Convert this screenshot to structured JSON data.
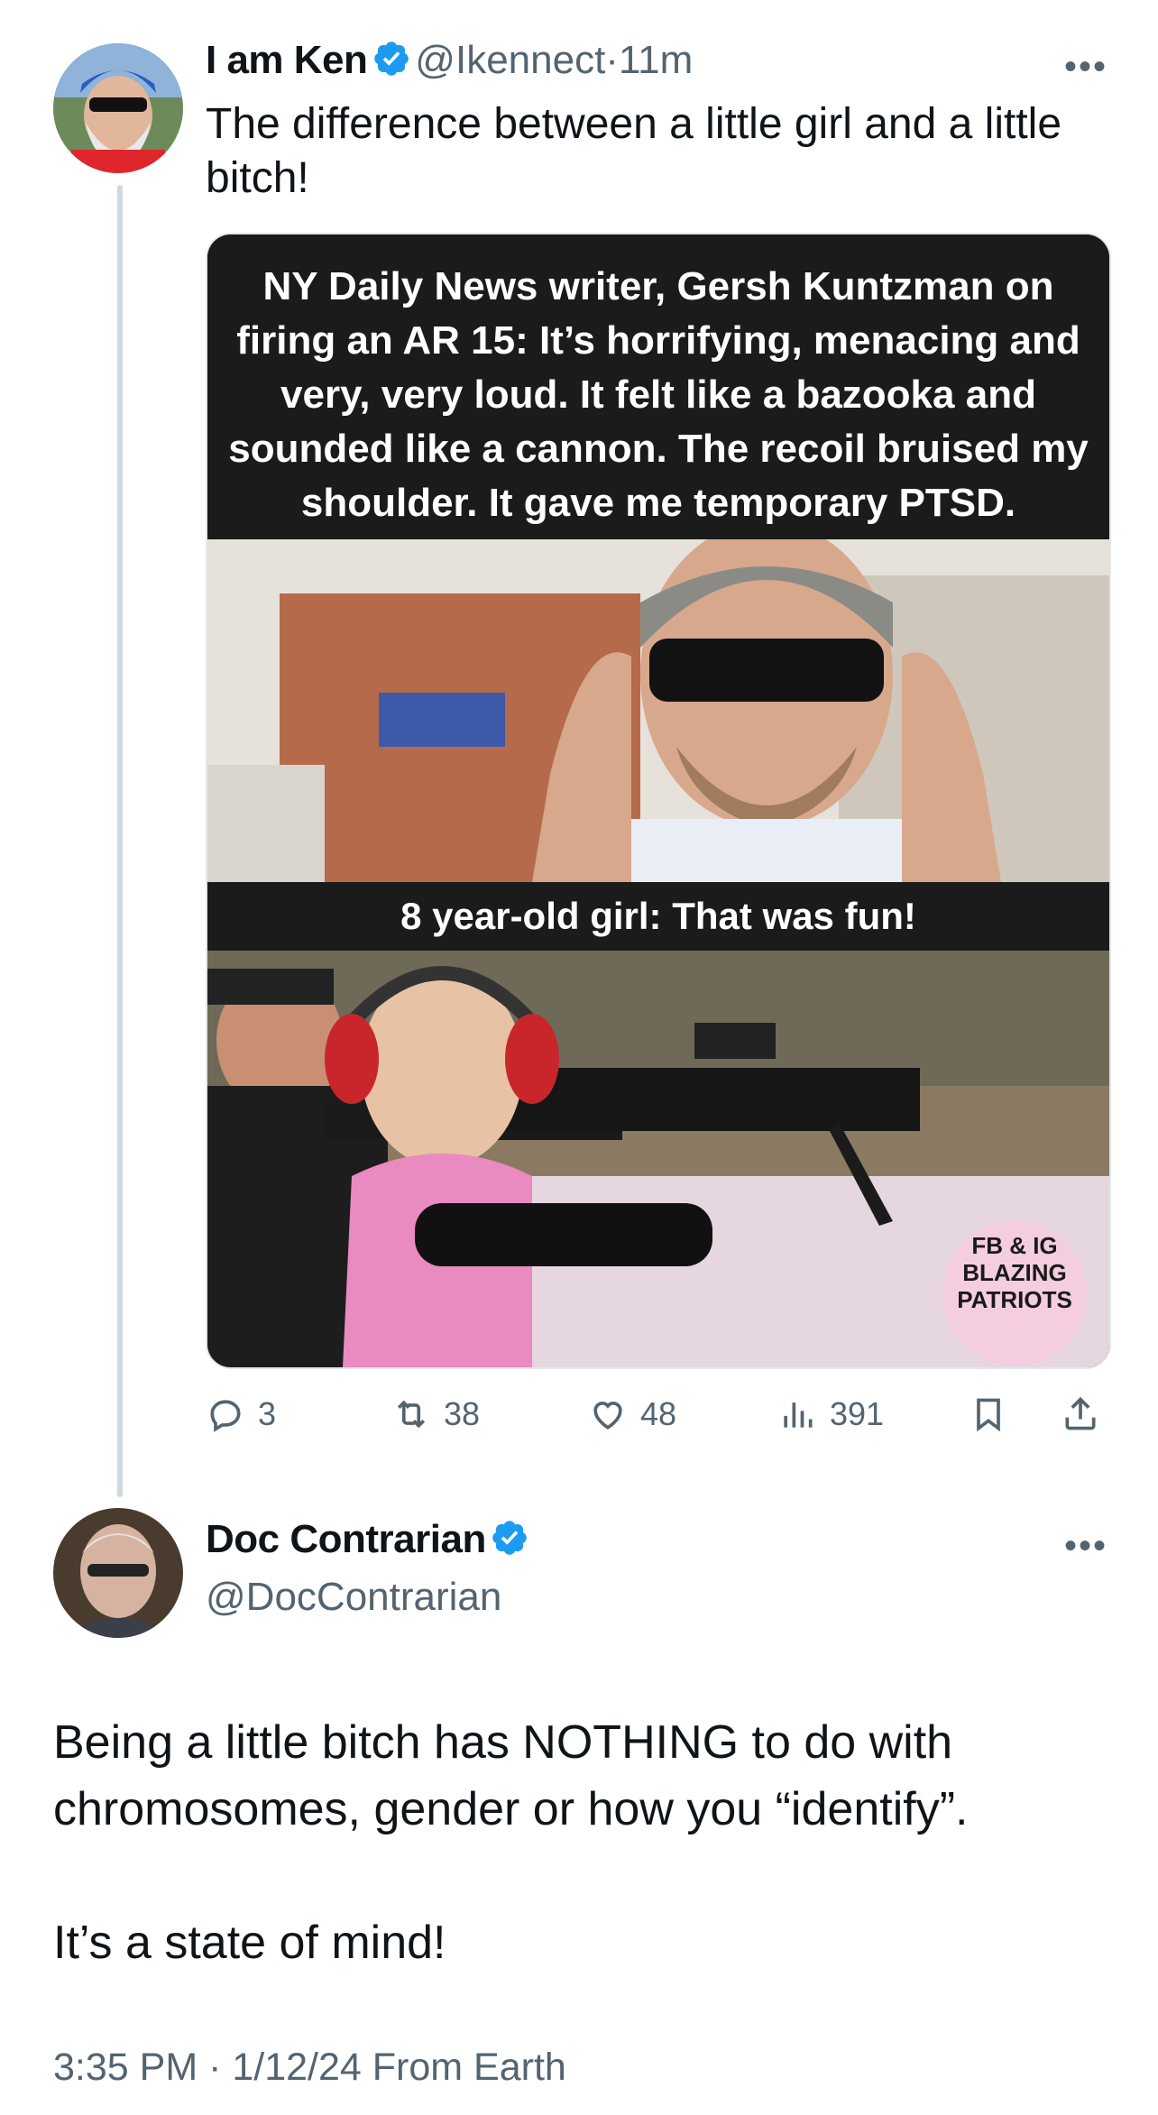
{
  "tweet1": {
    "name": "I am Ken",
    "handle": "@Ikennect",
    "dot": "·",
    "time": "11m",
    "text": "The difference between a little girl and a little bitch!",
    "more_label": "•••",
    "meme": {
      "top_caption": "NY Daily News writer, Gersh Kuntzman on firing an AR 15: It’s horrifying, menacing and very, very loud. It felt like a bazooka and sounded like a cannon. The recoil bruised my shoulder. It gave me temporary PTSD.",
      "mid_caption": "8 year-old girl: That was fun!",
      "stamp_line1": "FB & IG",
      "stamp_line2": "BLAZING",
      "stamp_line3": "PATRIOTS"
    },
    "actions": {
      "replies": "3",
      "retweets": "38",
      "likes": "48",
      "views": "391"
    }
  },
  "tweet2": {
    "name": "Doc Contrarian",
    "handle": "@DocContrarian",
    "more_label": "•••",
    "text": "Being a little bitch has NOTHING to do with chromosomes, gender or how you “identify”.\n\nIt’s a state of mind!",
    "footer": "3:35 PM · 1/12/24 From Earth"
  },
  "colors": {
    "verified": "#1d9bf0",
    "muted": "#536471",
    "thread_line": "#cfd9de"
  }
}
